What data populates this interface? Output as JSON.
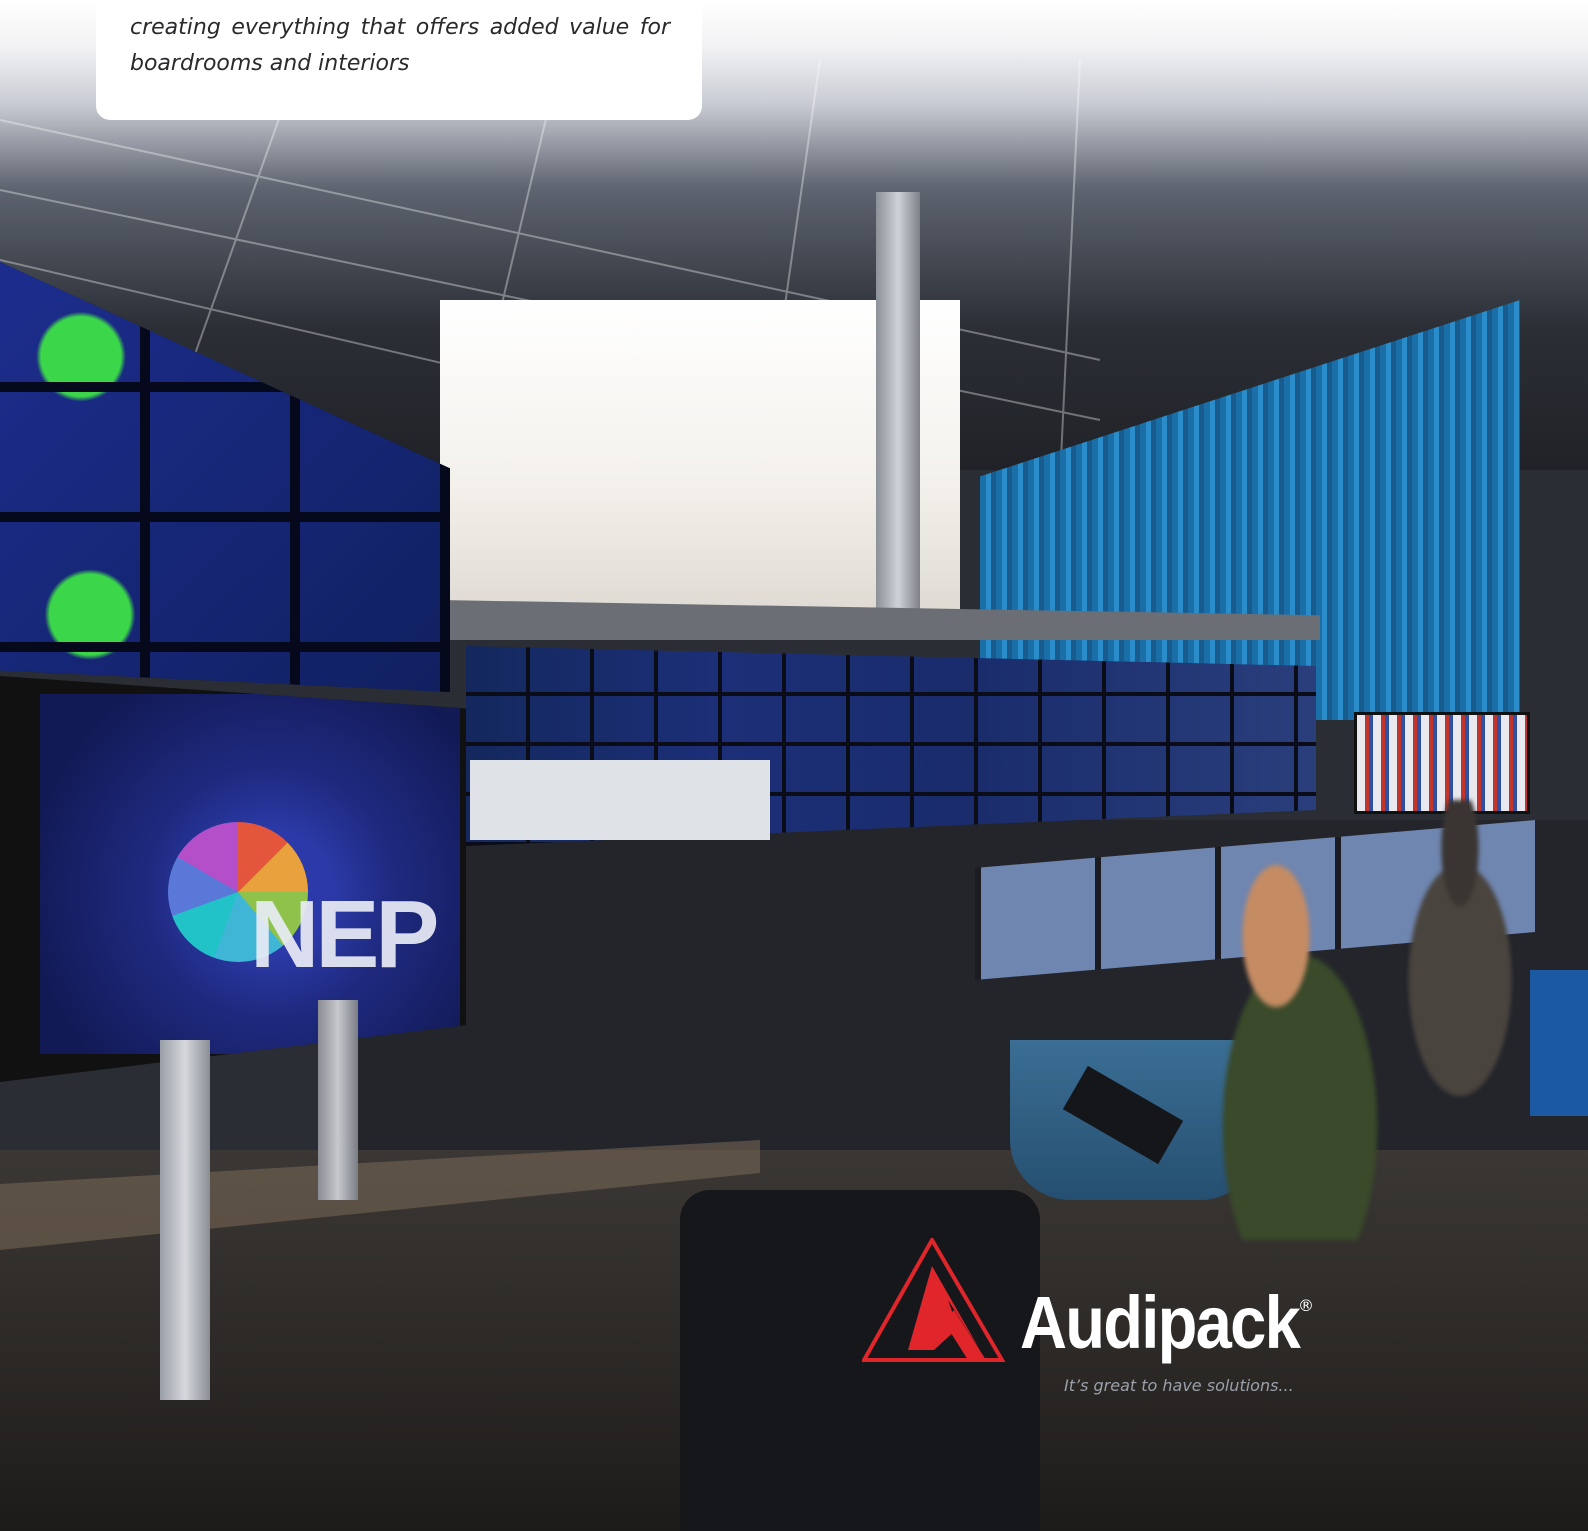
{
  "intro": {
    "text": "creating everything that offers added value for boardrooms and interiors"
  },
  "photo": {
    "description_icon": "control-room-photo-icon",
    "screen_brand": "NEP"
  },
  "logo": {
    "name": "Audipack",
    "registered_mark": "®",
    "tagline": "It’s great to have solutions...",
    "colors": {
      "triangle": "#e0252b",
      "text": "#ffffff",
      "tagline": "#9aa0aa"
    }
  },
  "accent": {
    "blue_tab": "#1b5aa3"
  }
}
